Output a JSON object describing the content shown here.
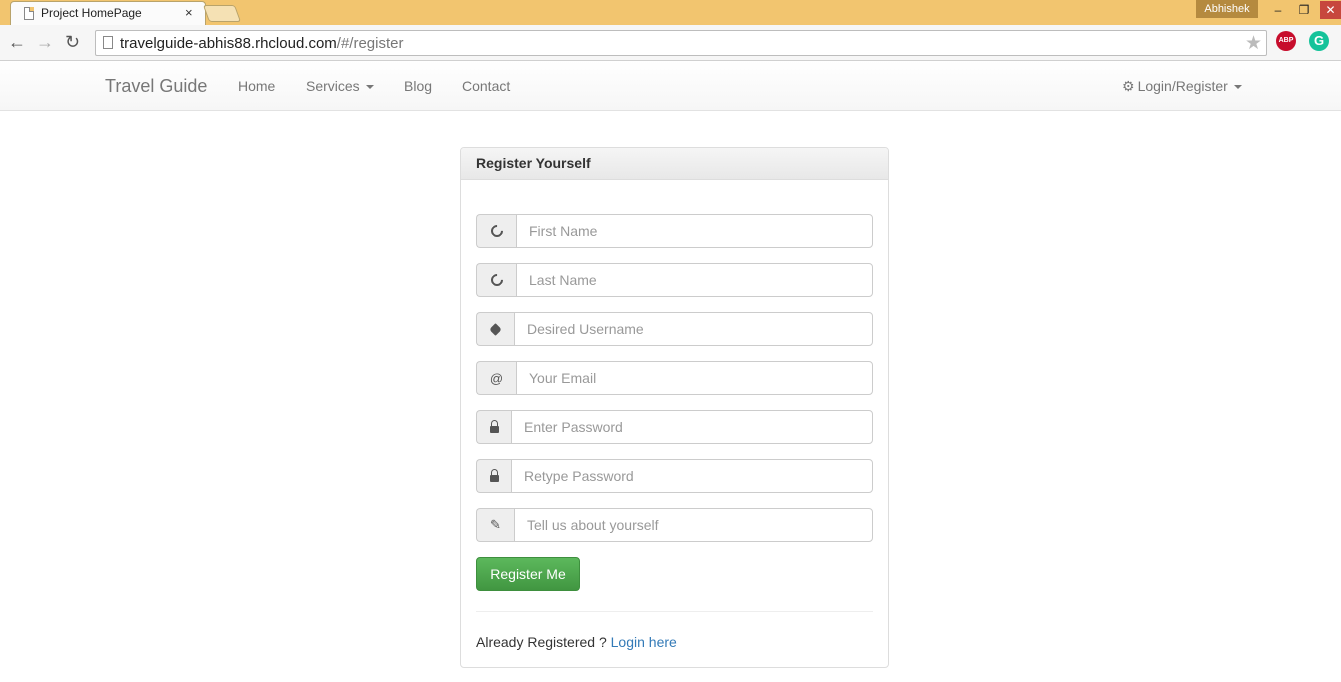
{
  "browser": {
    "tab_title": "Project HomePage",
    "tab_close": "×",
    "profile_name": "Abhishek",
    "window_min": "‒",
    "window_max": "❐",
    "window_close": "✕",
    "back": "←",
    "forward": "→",
    "reload": "↻",
    "url_host": "travelguide-abhis88.rhcloud.com",
    "url_path": "/#/register",
    "star": "★",
    "abp_label": "ABP",
    "grammarly_label": "G"
  },
  "navbar": {
    "brand": "Travel Guide",
    "home": "Home",
    "services": "Services",
    "blog": "Blog",
    "contact": "Contact",
    "login_register": "Login/Register",
    "gear": "⚙"
  },
  "form": {
    "title": "Register Yourself",
    "first_name_placeholder": "First Name",
    "last_name_placeholder": "Last Name",
    "username_placeholder": "Desired Username",
    "email_placeholder": "Your Email",
    "email_addon": "@",
    "password_placeholder": "Enter Password",
    "retype_password_placeholder": "Retype Password",
    "about_placeholder": "Tell us about yourself",
    "pencil": "✎",
    "submit_label": "Register Me",
    "already_text": "Already Registered ? ",
    "login_link": "Login here"
  },
  "icons": {
    "first_name": "circle-notch-icon",
    "last_name": "circle-notch-icon",
    "username": "tag-icon",
    "email": "at-icon",
    "password": "lock-icon",
    "retype_password": "lock-icon",
    "about": "pencil-icon"
  },
  "colors": {
    "chrome_frame": "#f2c56f",
    "register_button": "#5cb85c",
    "link": "#337ab7"
  }
}
